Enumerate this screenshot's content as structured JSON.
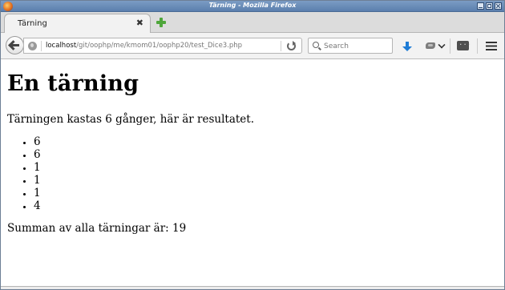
{
  "window": {
    "title": "Tärning - Mozilla Firefox"
  },
  "tabs": [
    {
      "label": "Tärning",
      "close_glyph": "✖"
    }
  ],
  "navbar": {
    "url_host": "localhost",
    "url_path": "/git/oophp/me/kmom01/oophp20/test_Dice3.php",
    "search_placeholder": "Search"
  },
  "page": {
    "heading": "En tärning",
    "intro": "Tärningen kastas 6 gånger, här är resultatet.",
    "results": [
      "6",
      "6",
      "1",
      "1",
      "1",
      "4"
    ],
    "sum_text": "Summan av alla tärningar är: 19"
  },
  "icons": {
    "app": "firefox-icon",
    "new_tab": "plus-icon",
    "back": "back-arrow-icon",
    "site": "globe-icon",
    "reload": "reload-icon",
    "search": "search-icon",
    "download": "download-arrow-icon",
    "addon": "addon-icon",
    "devtools": "devtools-icon",
    "menu": "hamburger-menu-icon"
  },
  "colors": {
    "titlebar": "#5b7fad",
    "download_accent": "#1e7cd6",
    "new_tab_accent": "#4ea63a"
  }
}
